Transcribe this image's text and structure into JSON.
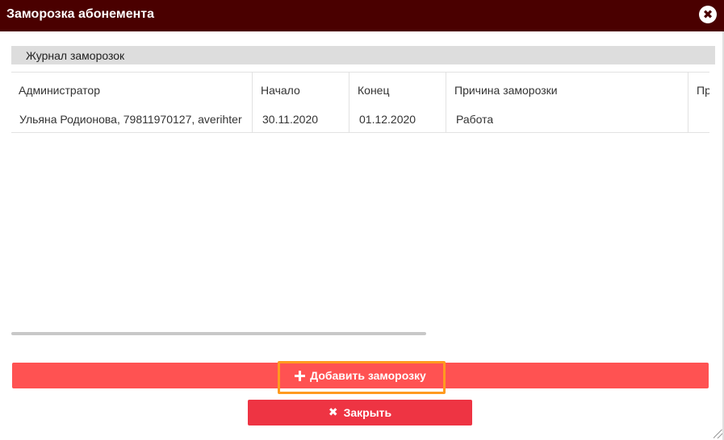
{
  "dialog": {
    "title": "Заморозка абонемента",
    "close_glyph": "✖"
  },
  "journal": {
    "header": "Журнал заморозок",
    "columns": [
      "Администратор",
      "Начало",
      "Конец",
      "Причина заморозки",
      "Пр"
    ],
    "rows": [
      {
        "admin": "Ульяна Родионова, 79811970127, averihter",
        "start": "30.11.2020",
        "end": "01.12.2020",
        "reason": "Работа",
        "extra": ""
      }
    ]
  },
  "actions": {
    "add_label": "Добавить заморозку",
    "close_label": "Закрыть",
    "x_glyph": "✖"
  },
  "colors": {
    "titlebar": "#4a0000",
    "add_button": "#ff5252",
    "close_button": "#ee3443",
    "focus_ring": "#ff9a1f"
  },
  "icons": {
    "close": "close-icon",
    "add": "plus-icon",
    "cancel": "x-icon"
  }
}
